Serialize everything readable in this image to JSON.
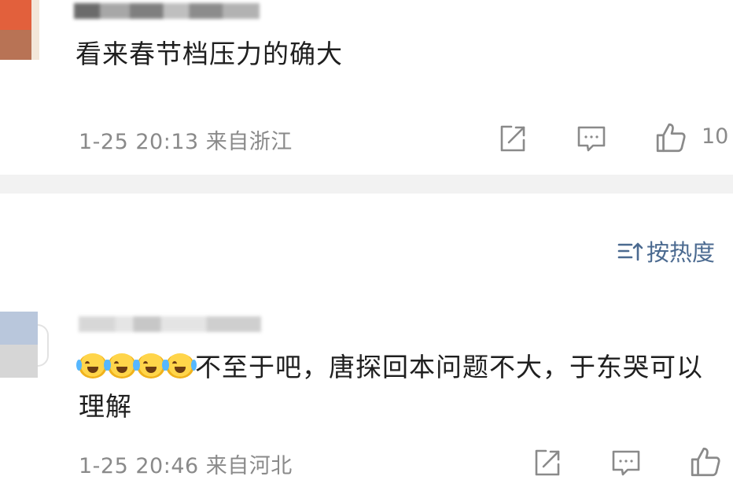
{
  "comments": [
    {
      "text": "看来春节档压力的确大",
      "time": "1-25 20:13",
      "location": "来自浙江",
      "likes": "10"
    },
    {
      "emoji_count": 4,
      "text": "不至于吧，唐探回本问题不大，于东哭可以理解",
      "time": "1-25 20:46",
      "location": "来自河北",
      "likes": ""
    }
  ],
  "sort": {
    "label": "按热度"
  },
  "icons": {
    "share": "share-icon",
    "comment": "comment-icon",
    "like": "thumbs-up-icon",
    "sort": "sort-icon",
    "emoji": "laugh-cry-emoji"
  },
  "colors": {
    "text": "#1f1f1f",
    "meta": "#8a8a8a",
    "accent": "#4b6a90",
    "divider": "#f2f2f2"
  }
}
